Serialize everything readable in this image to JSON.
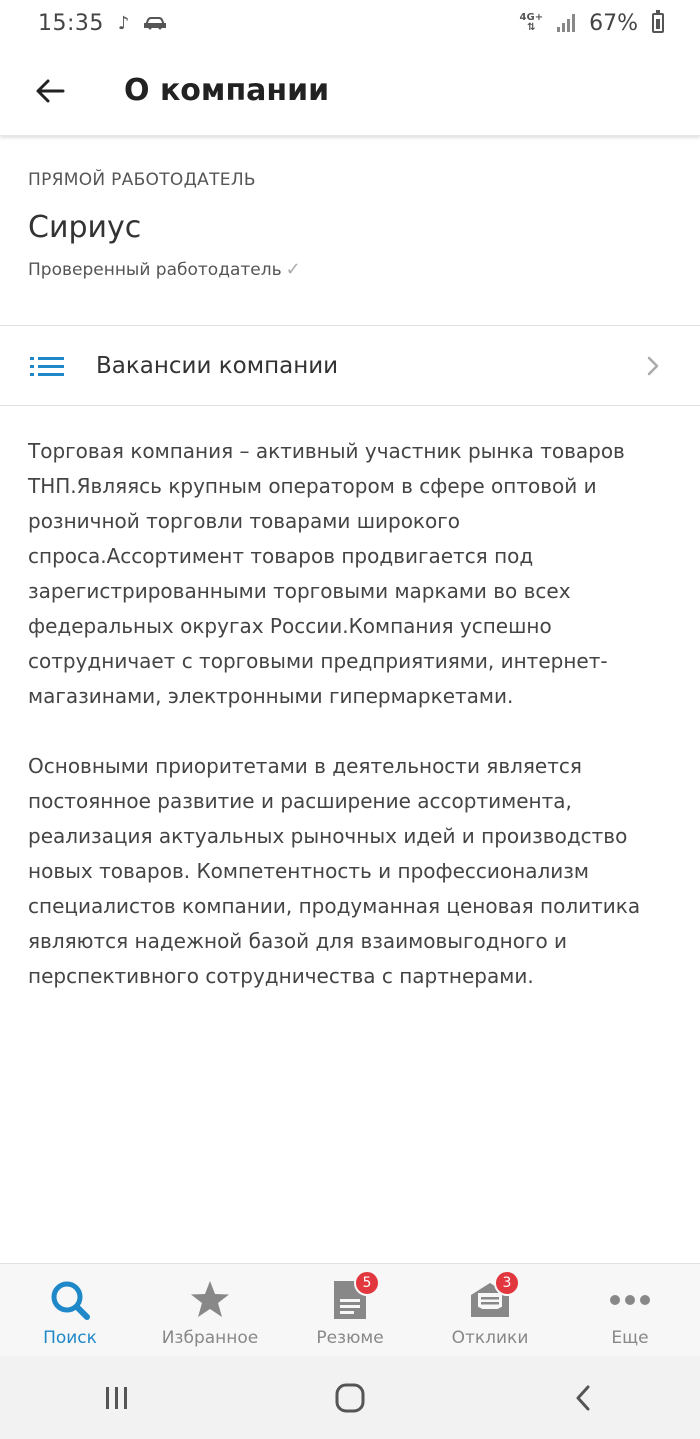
{
  "status_bar": {
    "time": "15:35",
    "network": "4G+",
    "battery": "67%"
  },
  "app_bar": {
    "title": "О компании"
  },
  "company": {
    "employer_type": "ПРЯМОЙ РАБОТОДАТЕЛЬ",
    "name": "Сириус",
    "verified_label": "Проверенный работодатель"
  },
  "vacancies": {
    "label": "Вакансии компании"
  },
  "description": {
    "paragraphs": [
      "Торговая компания – активный участник рынка товаров ТНП.Являясь крупным оператором в сфере оптовой и розничной торговли товарами широкого спроса.Ассортимент товаров продвигается под зарегистрированными торговыми марками  во всех федеральных округах России.Компания успешно сотрудничает с торговыми предприятиями, интернет-магазинами, электронными гипермаркетами.",
      "Основными приоритетами в деятельности является постоянное развитие и расширение ассортимента, реализация актуальных рыночных идей и производство новых товаров. Компетентность и профессионализм специалистов компании, продуманная ценовая политика являются надежной базой для взаимовыгодного и перспективного сотрудничества с партнерами."
    ]
  },
  "bottom_nav": {
    "items": [
      {
        "label": "Поиск",
        "icon": "search-icon",
        "active": true
      },
      {
        "label": "Избранное",
        "icon": "star-icon"
      },
      {
        "label": "Резюме",
        "icon": "document-icon",
        "badge": "5"
      },
      {
        "label": "Отклики",
        "icon": "envelope-icon",
        "badge": "3"
      },
      {
        "label": "Еще",
        "icon": "more-icon"
      }
    ]
  },
  "colors": {
    "accent": "#1e88c8",
    "badge": "#e2373f",
    "text": "#333333",
    "muted": "#888888"
  }
}
